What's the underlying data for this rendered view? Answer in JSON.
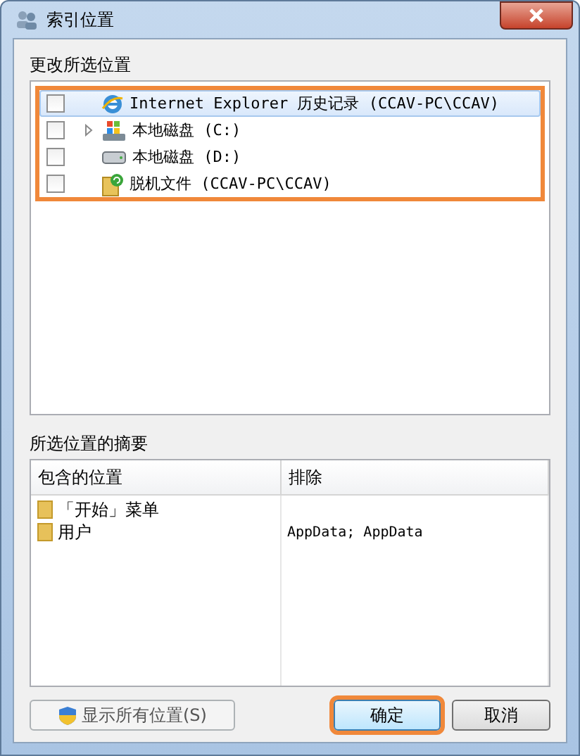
{
  "window": {
    "title": "索引位置"
  },
  "locations": {
    "label": "更改所选位置",
    "highlighted": true,
    "items": [
      {
        "kind": "ie",
        "label": "Internet Explorer 历史记录 (CCAV-PC\\CCAV)",
        "checked": false,
        "selected": true,
        "expandable": false
      },
      {
        "kind": "system-drive",
        "label": "本地磁盘 (C:)",
        "checked": false,
        "selected": false,
        "expandable": true
      },
      {
        "kind": "drive",
        "label": "本地磁盘 (D:)",
        "checked": false,
        "selected": false,
        "expandable": false
      },
      {
        "kind": "offline",
        "label": "脱机文件 (CCAV-PC\\CCAV)",
        "checked": false,
        "selected": false,
        "expandable": false
      }
    ]
  },
  "summary": {
    "label": "所选位置的摘要",
    "columns": [
      "包含的位置",
      "排除"
    ],
    "rows": [
      {
        "location": "「开始」菜单",
        "exclude": ""
      },
      {
        "location": "用户",
        "exclude": "AppData; AppData"
      }
    ]
  },
  "buttons": [
    {
      "kind": "shield",
      "label": "显示所有位置(S)",
      "highlighted": false
    },
    {
      "kind": "default",
      "label": "确定",
      "highlighted": true
    },
    {
      "kind": "plain",
      "label": "取消",
      "highlighted": false
    }
  ]
}
